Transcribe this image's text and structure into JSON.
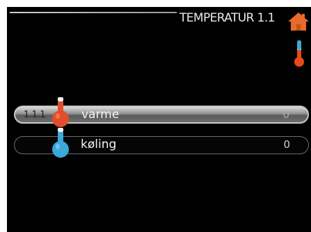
{
  "header": {
    "title": "TEMPERATUR 1.1",
    "home_icon": "home-icon",
    "status_icon": "thermometer-icon"
  },
  "menu": {
    "items": [
      {
        "number": "1.1.1",
        "label": "varme",
        "value": "0",
        "icon": "thermometer-hot-icon",
        "selected": true
      },
      {
        "number": "",
        "label": "køling",
        "value": "0",
        "icon": "thermometer-cold-icon",
        "selected": false
      }
    ]
  },
  "colors": {
    "accent_hot": "#e64a19",
    "accent_cold": "#3aa8d8",
    "home": "#e86a2a",
    "background": "#000000"
  }
}
